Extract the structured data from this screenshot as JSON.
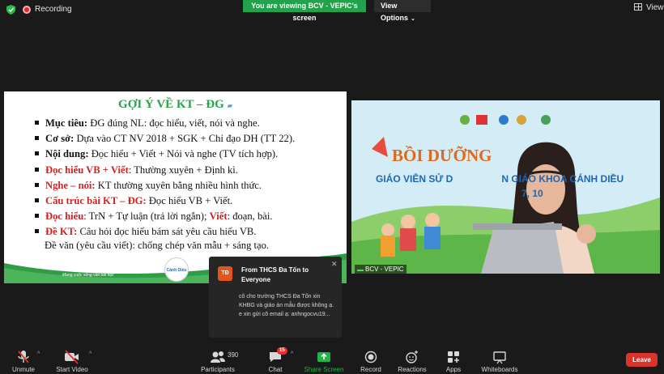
{
  "topbar": {
    "recording_label": "Recording",
    "viewing_banner": "You are viewing BCV - VEPIC's screen",
    "view_options": "View Options",
    "view_label": "View",
    "colors": {
      "banner": "#22a24a",
      "record": "#e02828"
    }
  },
  "slide": {
    "title": "GỢI Ý VỀ KT – ĐG",
    "bullets": [
      {
        "key": "Mục tiêu:",
        "text": " ĐG đúng NL: đọc hiểu, viết, nói và nghe.",
        "style": "bold"
      },
      {
        "key": "Cơ sở:",
        "text": " Dựa vào CT NV 2018 + SGK + Chỉ đạo DH (TT 22).",
        "style": "bold"
      },
      {
        "key": "Nội dung:",
        "text": " Đọc hiểu + Viết + Nói và nghe (TV tích hợp).",
        "style": "bold"
      },
      {
        "key": "Đọc hiểu VB + Viết",
        "text": ": Thường xuyên + Định kì.",
        "style": "red"
      },
      {
        "key": "Nghe – nói:",
        "text": " KT thường xuyên bằng nhiều hình thức.",
        "style": "red"
      },
      {
        "key": "Cấu trúc bài KT – ĐG:",
        "text": " Đọc hiểu VB + Viết.",
        "style": "red"
      },
      {
        "key": "Đọc hiểu",
        "text": ": TrN + Tự luận (trả lời ngắn); ",
        "key2": "Viết",
        "text2": ": đoạn, bài.",
        "style": "red"
      },
      {
        "key": "Đề KT:",
        "text": " Câu hỏi đọc hiểu bám sát yêu cầu hiểu VB.",
        "style": "red"
      }
    ],
    "last_line": "Đề văn (yêu cầu viết): chống chép văn mẫu + sáng tạo.",
    "slogan": "Mang cuộc sống vào bài học",
    "logo_text": "Cánh Diều",
    "colors": {
      "title": "#2aa14a",
      "emph": "#d41f1f"
    }
  },
  "video": {
    "banner_title": "BỒI DƯỠNG",
    "banner_sub_left": "GIÁO VIÊN SỬ D",
    "banner_sub_right": "N GIÁO KHOA CÁNH DIỀU",
    "banner_sub_num": "7, 10",
    "participant_label": "BCV - VEPIC"
  },
  "chat_toast": {
    "avatar": "TĐ",
    "title": "From THCS Đa Tốn to Everyone",
    "message": "cô cho trường THCS Đa Tốn xin KHBG và giáo án mẫu được không ạ. e xin gửi cô email ạ: anhngocvu19..."
  },
  "toolbar": {
    "unmute": "Unmute",
    "start_video": "Start Video",
    "participants": "Participants",
    "participant_count": "390",
    "chat": "Chat",
    "chat_badge": "15",
    "share_screen": "Share Screen",
    "record": "Record",
    "reactions": "Reactions",
    "apps": "Apps",
    "whiteboards": "Whiteboards",
    "leave": "Leave"
  }
}
